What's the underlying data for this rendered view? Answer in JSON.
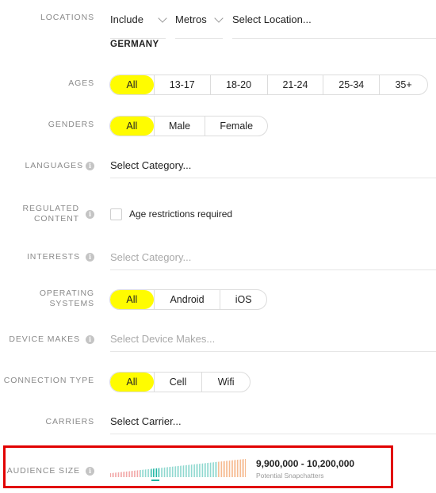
{
  "locations": {
    "label": "LOCATIONS",
    "include": "Include",
    "metros": "Metros",
    "placeholder": "Select Location...",
    "selected": "GERMANY"
  },
  "ages": {
    "label": "AGES",
    "options": [
      "All",
      "13-17",
      "18-20",
      "21-24",
      "25-34",
      "35+"
    ],
    "active": "All"
  },
  "genders": {
    "label": "GENDERS",
    "options": [
      "All",
      "Male",
      "Female"
    ],
    "active": "All"
  },
  "languages": {
    "label": "LANGUAGES",
    "placeholder": "Select Category..."
  },
  "regulated": {
    "label_line1": "REGULATED",
    "label_line2": "CONTENT",
    "checkbox_label": "Age restrictions required",
    "checked": false
  },
  "interests": {
    "label": "INTERESTS",
    "placeholder": "Select Category..."
  },
  "os": {
    "label_line1": "OPERATING",
    "label_line2": "SYSTEMS",
    "options": [
      "All",
      "Android",
      "iOS"
    ],
    "active": "All"
  },
  "device_makes": {
    "label": "DEVICE MAKES",
    "placeholder": "Select Device Makes..."
  },
  "connection": {
    "label": "CONNECTION TYPE",
    "options": [
      "All",
      "Cell",
      "Wifi"
    ],
    "active": "All"
  },
  "carriers": {
    "label": "CARRIERS",
    "placeholder": "Select Carrier..."
  },
  "audience": {
    "label": "AUDIENCE SIZE",
    "range": "9,900,000 - 10,200,000",
    "subtitle": "Potential Snapchatters",
    "highlight_color": "#e10000",
    "meter_position": 0.33
  },
  "info_icon_glyph": "i",
  "colors": {
    "accent": "#fffc00",
    "highlight": "#e10000"
  }
}
